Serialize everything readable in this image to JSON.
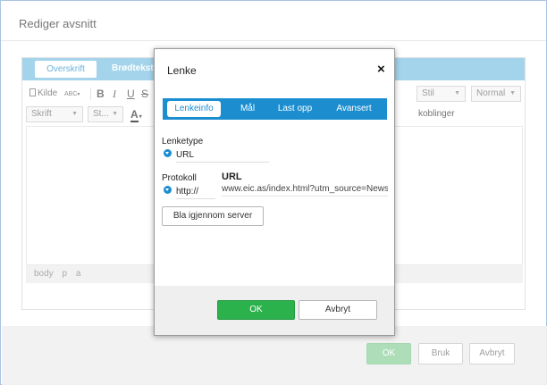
{
  "outer": {
    "title": "Rediger avsnitt",
    "tabs": [
      "Overskrift",
      "Brødtekst"
    ],
    "toolbar_row1": {
      "source_label": "Kilde",
      "spell_label": "ABC",
      "bold": "B",
      "italic": "I",
      "underline": "U",
      "strike": "S",
      "style_combo": "Stil",
      "format_combo": "Normal"
    },
    "toolbar_row2": {
      "font_combo": "Skrift",
      "size_combo": "St...",
      "color_label": "A",
      "links_label": "koblinger"
    },
    "status_path": [
      "body",
      "p",
      "a"
    ],
    "footer": {
      "ok": "OK",
      "apply": "Bruk",
      "cancel": "Avbryt"
    }
  },
  "dialog": {
    "title": "Lenke",
    "close": "×",
    "tabs": [
      "Lenkeinfo",
      "Mål",
      "Last opp",
      "Avansert"
    ],
    "active_tab": "Lenkeinfo",
    "link_type_label": "Lenketype",
    "link_type_value": "URL",
    "protocol_label": "Protokoll",
    "protocol_value": "http://",
    "url_label": "URL",
    "url_value": "www.eic.as/index.html?utm_source=Newsletter",
    "browse_button": "Bla igjennom server",
    "ok": "OK",
    "cancel": "Avbryt"
  },
  "colors": {
    "accent_blue": "#1c8ed0",
    "tab_bar_light": "#91cbe7",
    "ok_green": "#2bb24c",
    "ok_green_disabled": "#9bd7a9"
  },
  "icons": {
    "source": "source-doc-icon",
    "spellcheck": "spellcheck-icon",
    "dropdown": "chevron-down-icon",
    "close": "close-icon",
    "select_badge": "dropdown-badge-icon"
  }
}
